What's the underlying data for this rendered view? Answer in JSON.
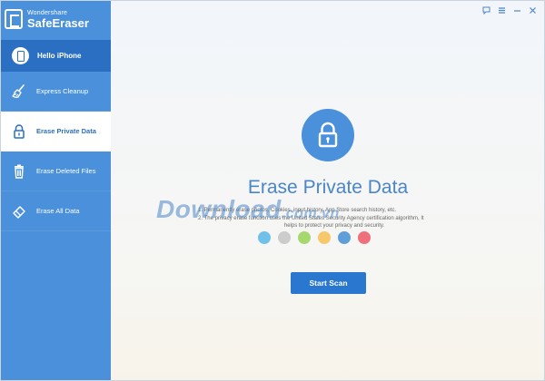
{
  "app": {
    "brand": "Wondershare",
    "product": "SafeEraser"
  },
  "device": {
    "label": "Hello iPhone",
    "icon": "phone-icon"
  },
  "sidebar": {
    "items": [
      {
        "label": "Express Cleanup",
        "icon": "broom-icon",
        "active": false
      },
      {
        "label": "Erase Private Data",
        "icon": "lock-icon",
        "active": true
      },
      {
        "label": "Erase Deleted Files",
        "icon": "trash-icon",
        "active": false
      },
      {
        "label": "Erase All Data",
        "icon": "eraser-icon",
        "active": false
      }
    ]
  },
  "window_controls": [
    "feedback-icon",
    "menu-icon",
    "minimize-icon",
    "close-icon"
  ],
  "main": {
    "title": "Erase Private Data",
    "description": {
      "line1": "1. Permanently erase photos, Cookies, input history, App Store search history, etc.",
      "line2": "2. The privacy erase function uses the United States Security Agency certification algorithm, It",
      "line3": "helps to protect your privacy and security."
    },
    "dot_colors": [
      "#6fc1ea",
      "#cccccc",
      "#a6d86e",
      "#f7c86a",
      "#5f9fd9",
      "#ef6f7a"
    ],
    "scan_button": "Start Scan"
  },
  "watermark": {
    "text": "Download",
    "suffix": ".com.vn"
  },
  "colors": {
    "sidebar": "#4a90db",
    "sidebar_dark": "#2a6fc2",
    "accent": "#2a77cf",
    "title": "#4a86c8"
  }
}
